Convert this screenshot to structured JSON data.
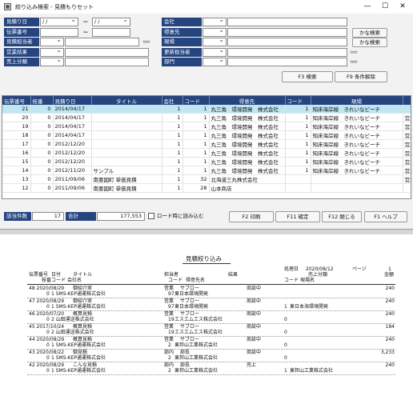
{
  "window": {
    "title": "絞り込み検索 - 見積もりセット",
    "app_icon": "grid-icon",
    "controls": [
      "—",
      "☐",
      "✕"
    ]
  },
  "form": {
    "labels": {
      "estimate_date": "見積り日",
      "estimate_no": "伝票番号",
      "estimate_staff": "見積担当者",
      "sales_result": "営業結果",
      "sales_type": "売上分類",
      "company": "会社",
      "customer": "得意先",
      "site": "現場",
      "updater": "更新担当者",
      "dept": "部門"
    },
    "date_from": " /   /",
    "date_to": " /   /",
    "tilde": "~"
  },
  "buttons": {
    "kana_search_1": "かな検索",
    "kana_search_2": "かな検索",
    "f3_search": "F3 検索",
    "f9_clear": "F9 条件解除",
    "f2_print": "F2 印刷",
    "f11_confirm": "F11 確定",
    "f12_close": "F12 閉じる",
    "f1_help": "F1 ヘルプ"
  },
  "grid": {
    "headers": [
      "伝票番号",
      "枝番",
      "見積り日",
      "タイトル",
      "会社",
      "コード",
      "得意先",
      "コード",
      "現場",
      ""
    ],
    "rows": [
      {
        "no": "21",
        "branch": "0",
        "date": "2014/04/17",
        "title": "",
        "co": "1",
        "code": "1",
        "customer": "丸三角　環境開発　株式会社",
        "scode": "1",
        "site": "知床海岸線　きれいなビーチ",
        "extra": ""
      },
      {
        "no": "20",
        "branch": "0",
        "date": "2014/04/17",
        "title": "",
        "co": "1",
        "code": "1",
        "customer": "丸三角　環境開発　株式会社",
        "scode": "1",
        "site": "知床海岸線　きれいなビーチ",
        "extra": "営業"
      },
      {
        "no": "19",
        "branch": "0",
        "date": "2014/04/17",
        "title": "",
        "co": "1",
        "code": "1",
        "customer": "丸三角　環境開発　株式会社",
        "scode": "1",
        "site": "知床海岸線　きれいなビーチ",
        "extra": "営業"
      },
      {
        "no": "18",
        "branch": "0",
        "date": "2014/04/17",
        "title": "",
        "co": "1",
        "code": "1",
        "customer": "丸三角　環境開発　株式会社",
        "scode": "1",
        "site": "知床海岸線　きれいなビーチ",
        "extra": "営業"
      },
      {
        "no": "17",
        "branch": "0",
        "date": "2012/12/20",
        "title": "",
        "co": "1",
        "code": "1",
        "customer": "丸三角　環境開発　株式会社",
        "scode": "1",
        "site": "知床海岸線　きれいなビーチ",
        "extra": "営業"
      },
      {
        "no": "16",
        "branch": "0",
        "date": "2012/12/20",
        "title": "",
        "co": "1",
        "code": "1",
        "customer": "丸三角　環境開発　株式会社",
        "scode": "1",
        "site": "知床海岸線　きれいなビーチ",
        "extra": "営業"
      },
      {
        "no": "15",
        "branch": "0",
        "date": "2012/12/20",
        "title": "",
        "co": "1",
        "code": "1",
        "customer": "丸三角　環境開発　株式会社",
        "scode": "1",
        "site": "知床海岸線　きれいなビーチ",
        "extra": "営業"
      },
      {
        "no": "14",
        "branch": "0",
        "date": "2012/11/20",
        "title": "サンプル",
        "co": "1",
        "code": "1",
        "customer": "丸三角　環境開発　株式会社",
        "scode": "1",
        "site": "知床海岸線　きれいなビーチ",
        "extra": "営業"
      },
      {
        "no": "13",
        "branch": "0",
        "date": "2011/09/06",
        "title": "南亜図町 単価見積",
        "co": "1",
        "code": "32",
        "customer": "北海道三丸株式会社",
        "scode": "",
        "site": "",
        "extra": "営業"
      },
      {
        "no": "12",
        "branch": "0",
        "date": "2011/09/06",
        "title": "南亜図町 単価見積",
        "co": "1",
        "code": "28",
        "customer": "山本商店",
        "scode": "",
        "site": "",
        "extra": ""
      }
    ]
  },
  "footer": {
    "count_label": "該当件数",
    "count_value": "17",
    "total_label": "合計",
    "total_value": "177,553",
    "checkbox_label": "ロード時に読み込む"
  },
  "report": {
    "title": "見積絞り込み",
    "processed_label": "処理日",
    "processed_date": "2020/08/12",
    "page_label": "ページ",
    "page_value": "1",
    "sales_type_label": "売上分類",
    "amount_label": "金額",
    "h_no": "伝票番号",
    "h_date": "日付",
    "h_title": "タイトル",
    "h_staff": "担当者",
    "h_result": "結果",
    "h_branch": "枝番",
    "h_code": "コード",
    "h_company": "会社名",
    "h_custcode": "コード",
    "h_custname": "得意先名",
    "h_sitecode": "コード",
    "h_sitename": "現場名",
    "entries": [
      {
        "l1a": "48 2020/08/29",
        "l1b": "御紹介実",
        "l1c": "営業",
        "l1d": "サブロー",
        "l1e": "商談中",
        "l1f": "240",
        "l2a": "0",
        "l2b": "1 SMS-KEP通運株式会社",
        "l2c": "97",
        "l2d": "東日本環境開発",
        "l2e": "",
        "l2f": ""
      },
      {
        "l1a": "47 2020/08/29",
        "l1b": "御紹介実",
        "l1c": "営業",
        "l1d": "サブロー",
        "l1e": "商談中",
        "l1f": "240",
        "l2a": "0",
        "l2b": "1 SMS-KEP通運株式会社",
        "l2c": "97",
        "l2d": "東日本環境開発",
        "l2e": "1",
        "l2f": "東日本海環境開発"
      },
      {
        "l1a": "46 2020/07/20",
        "l1b": "概算見積",
        "l1c": "営業",
        "l1d": "サブロー",
        "l1e": "商談中",
        "l1f": "240",
        "l2a": "0",
        "l2b": "2 山田運送株式会社",
        "l2c": "19",
        "l2d": "エスエムエス株式会社",
        "l2e": "0",
        "l2f": ""
      },
      {
        "l1a": "45 2017/10/24",
        "l1b": "概算見積",
        "l1c": "営業",
        "l1d": "サブロー",
        "l1e": "商談中",
        "l1f": "184",
        "l2a": "0",
        "l2b": "2 山田運送株式会社",
        "l2c": "19",
        "l2d": "エスエムエス株式会社",
        "l2e": "0",
        "l2f": ""
      },
      {
        "l1a": "44 2020/08/29",
        "l1b": "概算見積",
        "l1c": "営業",
        "l1d": "サブロー",
        "l1e": "商談中",
        "l1f": "240",
        "l2a": "0",
        "l2b": "1 SMS-KEP通運株式会社",
        "l2c": "2",
        "l2d": "東邦山工業株式会社",
        "l2e": "0",
        "l2f": ""
      },
      {
        "l1a": "43 2020/08/22",
        "l1b": "御見積",
        "l1c": "部内",
        "l1d": "部長",
        "l1e": "商談中",
        "l1f": "3,233",
        "l2a": "0",
        "l2b": "1 SMS-KEP通運株式会社",
        "l2c": "2",
        "l2d": "東邦山工業株式会社",
        "l2e": "0",
        "l2f": ""
      },
      {
        "l1a": "42 2020/08/29",
        "l1b": "こんな見積",
        "l1c": "部内",
        "l1d": "部長",
        "l1e": "売上",
        "l1f": "240",
        "l2a": "0",
        "l2b": "1 SMS-KEP通運株式会社",
        "l2c": "2",
        "l2d": "東邦山工業株式会社",
        "l2e": "1",
        "l2f": "東邦山工業株式会社"
      }
    ]
  }
}
